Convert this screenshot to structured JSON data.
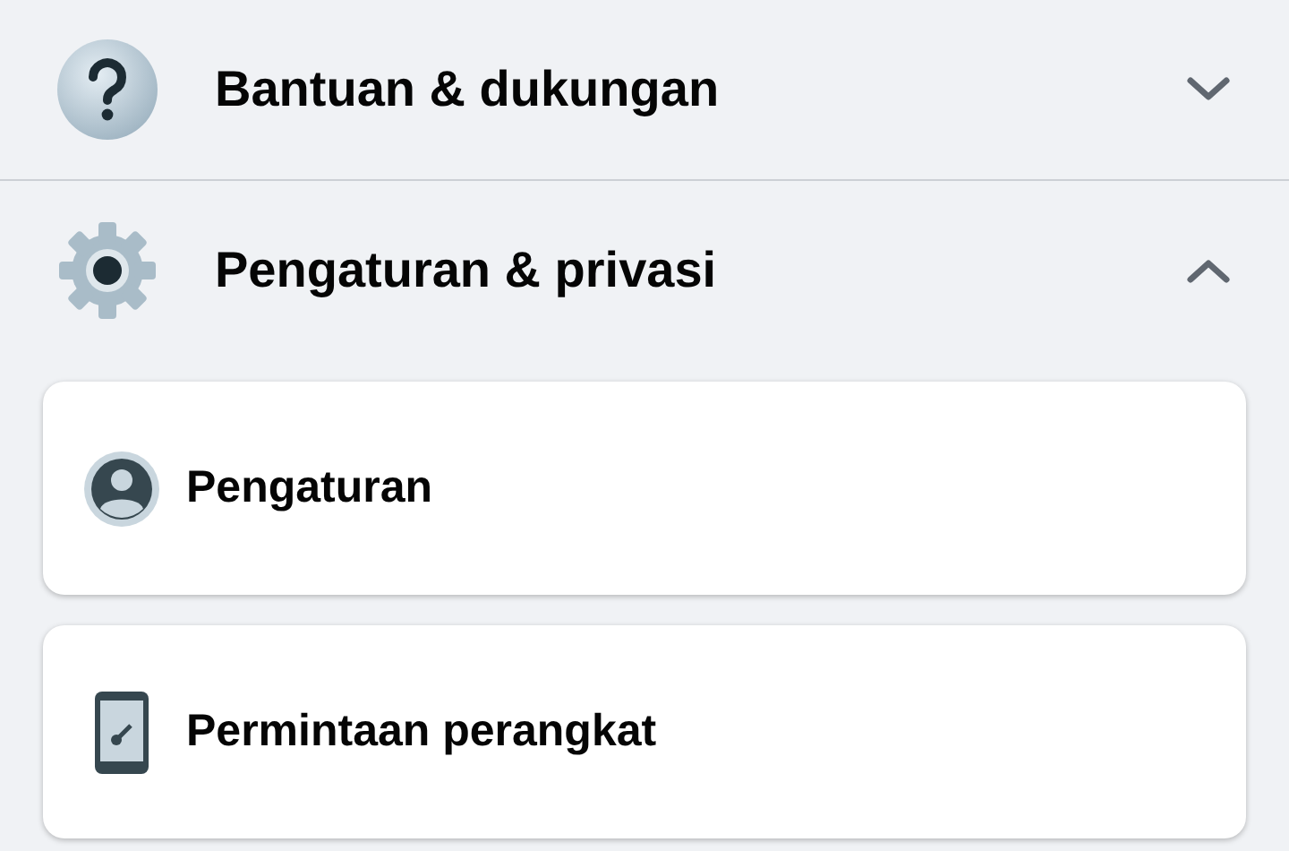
{
  "menu": [
    {
      "label": "Bantuan & dukungan",
      "expanded": false
    },
    {
      "label": "Pengaturan & privasi",
      "expanded": true,
      "children": [
        {
          "label": "Pengaturan"
        },
        {
          "label": "Permintaan perangkat"
        }
      ]
    }
  ]
}
